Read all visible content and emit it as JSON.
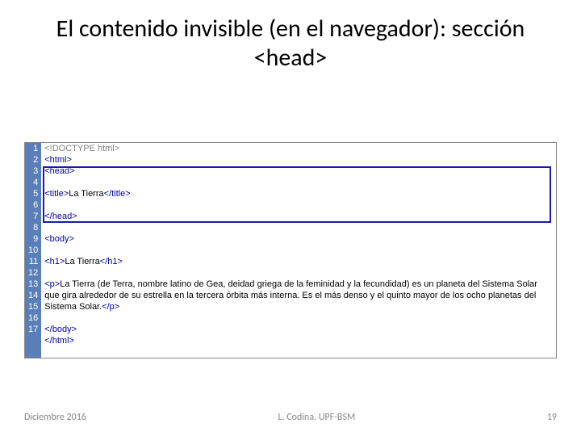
{
  "title": "El contenido invisible (en el navegador): sección <head>",
  "lines": {
    "n1": "1",
    "n2": "2",
    "n3": "3",
    "n4": "4",
    "n5": "5",
    "n6": "6",
    "n7": "7",
    "n8": "8",
    "n9": "9",
    "n10": "10",
    "n11": "11",
    "n12": "12",
    "n13": "13",
    "n14": "14",
    "n15": "15",
    "n16": "16",
    "n17": "17"
  },
  "code": {
    "l1": "<!DOCTYPE html>",
    "l2": "<html>",
    "l3a": "<head>",
    "l5a": "<title>",
    "l5b": "La Tierra",
    "l5c": "</title>",
    "l7a": "</head>",
    "l9a": "<body>",
    "l11a": "<h1>",
    "l11b": "La Tierra",
    "l11c": "</h1>",
    "l13a": "<p>",
    "l13b": "La Tierra (de Terra, nombre latino de Gea, deidad griega de la feminidad y la fecundidad) es un planeta del Sistema Solar que gira alrededor de su estrella en la tercera órbita más interna. Es el más denso y el quinto mayor de los ocho planetas del Sistema Solar.",
    "l13c": "</p>",
    "l15a": "</body>",
    "l16a": "</html>"
  },
  "footer": {
    "left": "Diciembre 2016",
    "center": "L. Codina. UPF-BSM",
    "right": "19"
  }
}
